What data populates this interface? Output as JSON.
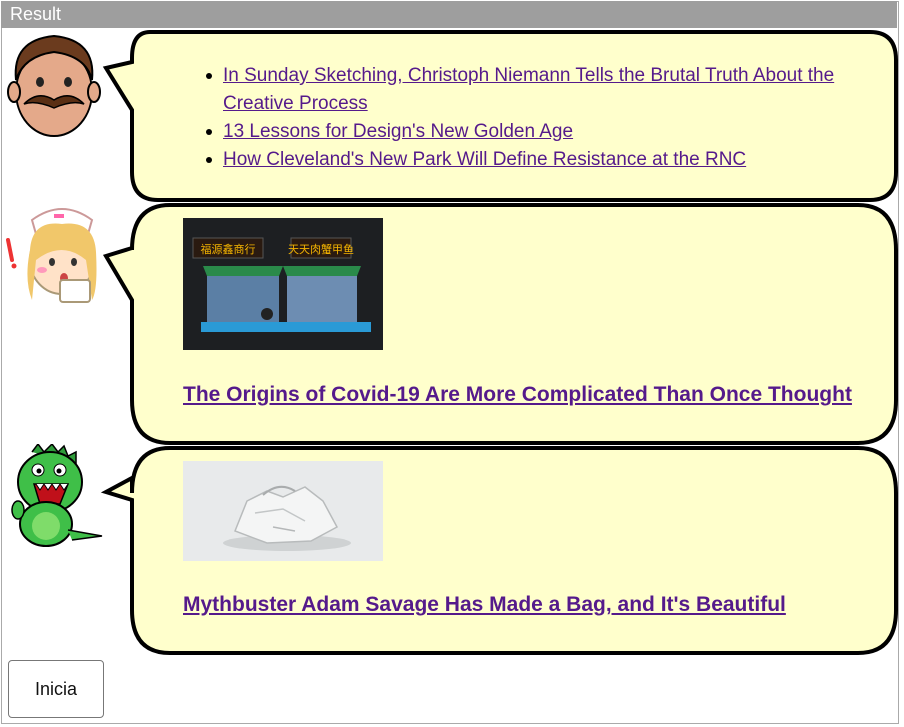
{
  "window": {
    "title": "Result"
  },
  "messages": [
    {
      "avatar": "mustache-man-avatar-icon",
      "links": [
        "In Sunday Sketching, Christoph Niemann Tells the Brutal Truth About the Creative Process",
        "13 Lessons for Design's New Golden Age",
        "How Cleveland's New Park Will Define Resistance at the RNC"
      ]
    },
    {
      "avatar": "nurse-avatar-icon",
      "image": "shuttered-market-stall-photo",
      "headline": "The Origins of Covid-19 Are More Complicated Than Once Thought"
    },
    {
      "avatar": "green-dinosaur-avatar-icon",
      "image": "crumpled-white-bag-photo",
      "headline": "Mythbuster Adam Savage Has Made a Bag, and It's Beautiful"
    }
  ],
  "controls": {
    "start_label": "Inicia"
  },
  "colors": {
    "bubble_fill": "#ffffcc",
    "bubble_stroke": "#000000",
    "link": "#551a8b",
    "titlebar": "#9e9e9e"
  }
}
